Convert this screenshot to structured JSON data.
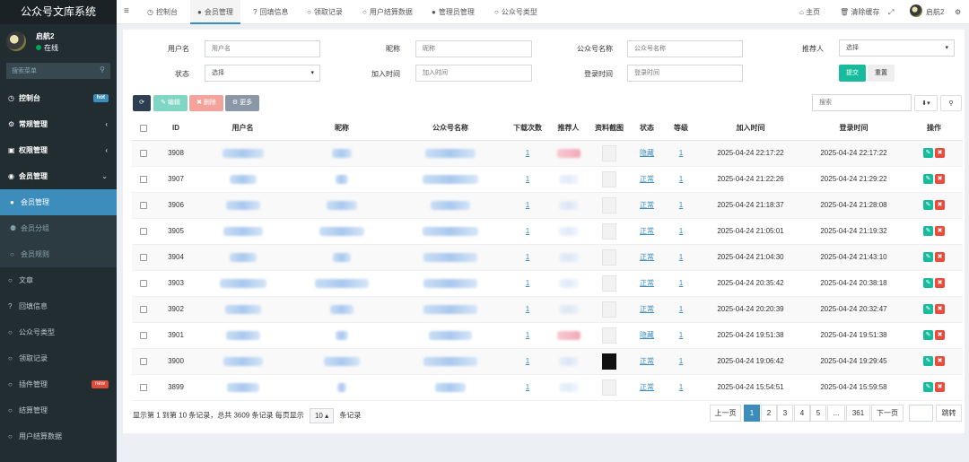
{
  "app": {
    "title": "公众号文库系统"
  },
  "user": {
    "name": "启航2",
    "status": "在线"
  },
  "sidebar": {
    "search_placeholder": "搜索菜单",
    "items": [
      {
        "label": "控制台",
        "badge": "hot",
        "badge_color": "#3c8dbc"
      },
      {
        "label": "常规管理"
      },
      {
        "label": "权限管理"
      },
      {
        "label": "会员管理"
      },
      {
        "label": "会员管理"
      },
      {
        "label": "会员分组"
      },
      {
        "label": "会员规则"
      },
      {
        "label": "文章"
      },
      {
        "label": "回填信息"
      },
      {
        "label": "公众号类型"
      },
      {
        "label": "领取记录"
      },
      {
        "label": "插件管理",
        "badge": "new",
        "badge_color": "#dd4b39"
      },
      {
        "label": "结算管理"
      },
      {
        "label": "用户结算数据"
      }
    ]
  },
  "topbar": {
    "tabs": [
      "控制台",
      "会员管理",
      "回填信息",
      "领取记录",
      "用户结算数据",
      "管理员管理",
      "公众号类型"
    ],
    "home": "主页",
    "clear_cache": "清除缓存",
    "user": "启航2"
  },
  "filters": {
    "username_label": "用户名",
    "username_placeholder": "用户名",
    "nickname_label": "昵称",
    "nickname_placeholder": "昵称",
    "account_label": "公众号名称",
    "account_placeholder": "公众号名称",
    "referrer_label": "推荐人",
    "referrer_value": "选择",
    "status_label": "状态",
    "status_value": "选择",
    "jointime_label": "加入时间",
    "jointime_placeholder": "加入时间",
    "logintime_label": "登录时间",
    "logintime_placeholder": "登录时间",
    "submit": "提交",
    "reset": "重置"
  },
  "toolbar": {
    "edit": "编辑",
    "delete": "删除",
    "more": "更多",
    "search_placeholder": "搜索"
  },
  "table": {
    "headers": [
      "ID",
      "用户名",
      "昵称",
      "公众号名称",
      "下载次数",
      "推荐人",
      "资料截图",
      "状态",
      "等级",
      "加入时间",
      "登录时间",
      "操作"
    ],
    "rows": [
      {
        "id": "3908",
        "downloads": "1",
        "status": "隐藏",
        "level": "1",
        "jointime": "2025-04-24 22:17:22",
        "logintime": "2025-04-24 22:17:22"
      },
      {
        "id": "3907",
        "downloads": "1",
        "status": "正常",
        "level": "1",
        "jointime": "2025-04-24 21:22:26",
        "logintime": "2025-04-24 21:29:22"
      },
      {
        "id": "3906",
        "downloads": "1",
        "status": "正常",
        "level": "1",
        "jointime": "2025-04-24 21:18:37",
        "logintime": "2025-04-24 21:28:08"
      },
      {
        "id": "3905",
        "downloads": "1",
        "status": "正常",
        "level": "1",
        "jointime": "2025-04-24 21:05:01",
        "logintime": "2025-04-24 21:19:32"
      },
      {
        "id": "3904",
        "downloads": "1",
        "status": "正常",
        "level": "1",
        "jointime": "2025-04-24 21:04:30",
        "logintime": "2025-04-24 21:43:10"
      },
      {
        "id": "3903",
        "downloads": "1",
        "status": "正常",
        "level": "1",
        "jointime": "2025-04-24 20:35:42",
        "logintime": "2025-04-24 20:38:18"
      },
      {
        "id": "3902",
        "downloads": "1",
        "status": "正常",
        "level": "1",
        "jointime": "2025-04-24 20:20:39",
        "logintime": "2025-04-24 20:32:47"
      },
      {
        "id": "3901",
        "downloads": "1",
        "status": "隐藏",
        "level": "1",
        "jointime": "2025-04-24 19:51:38",
        "logintime": "2025-04-24 19:51:38"
      },
      {
        "id": "3900",
        "downloads": "1",
        "status": "正常",
        "level": "1",
        "jointime": "2025-04-24 19:06:42",
        "logintime": "2025-04-24 19:29:45"
      },
      {
        "id": "3899",
        "downloads": "1",
        "status": "正常",
        "level": "1",
        "jointime": "2025-04-24 15:54:51",
        "logintime": "2025-04-24 15:59:58"
      }
    ]
  },
  "pagination": {
    "info_prefix": "显示第 1 到第 10 条记录，总共 3609 条记录 每页显示",
    "page_size": "10",
    "info_suffix": "条记录",
    "prev": "上一页",
    "pages": [
      "1",
      "2",
      "3",
      "4",
      "5",
      "...",
      "361"
    ],
    "next": "下一页",
    "jump": "跳转"
  },
  "colors": {
    "sidebar_bg": "#222d32",
    "accent": "#3c8dbc",
    "success": "#18bc9c",
    "danger": "#e74c3c"
  }
}
